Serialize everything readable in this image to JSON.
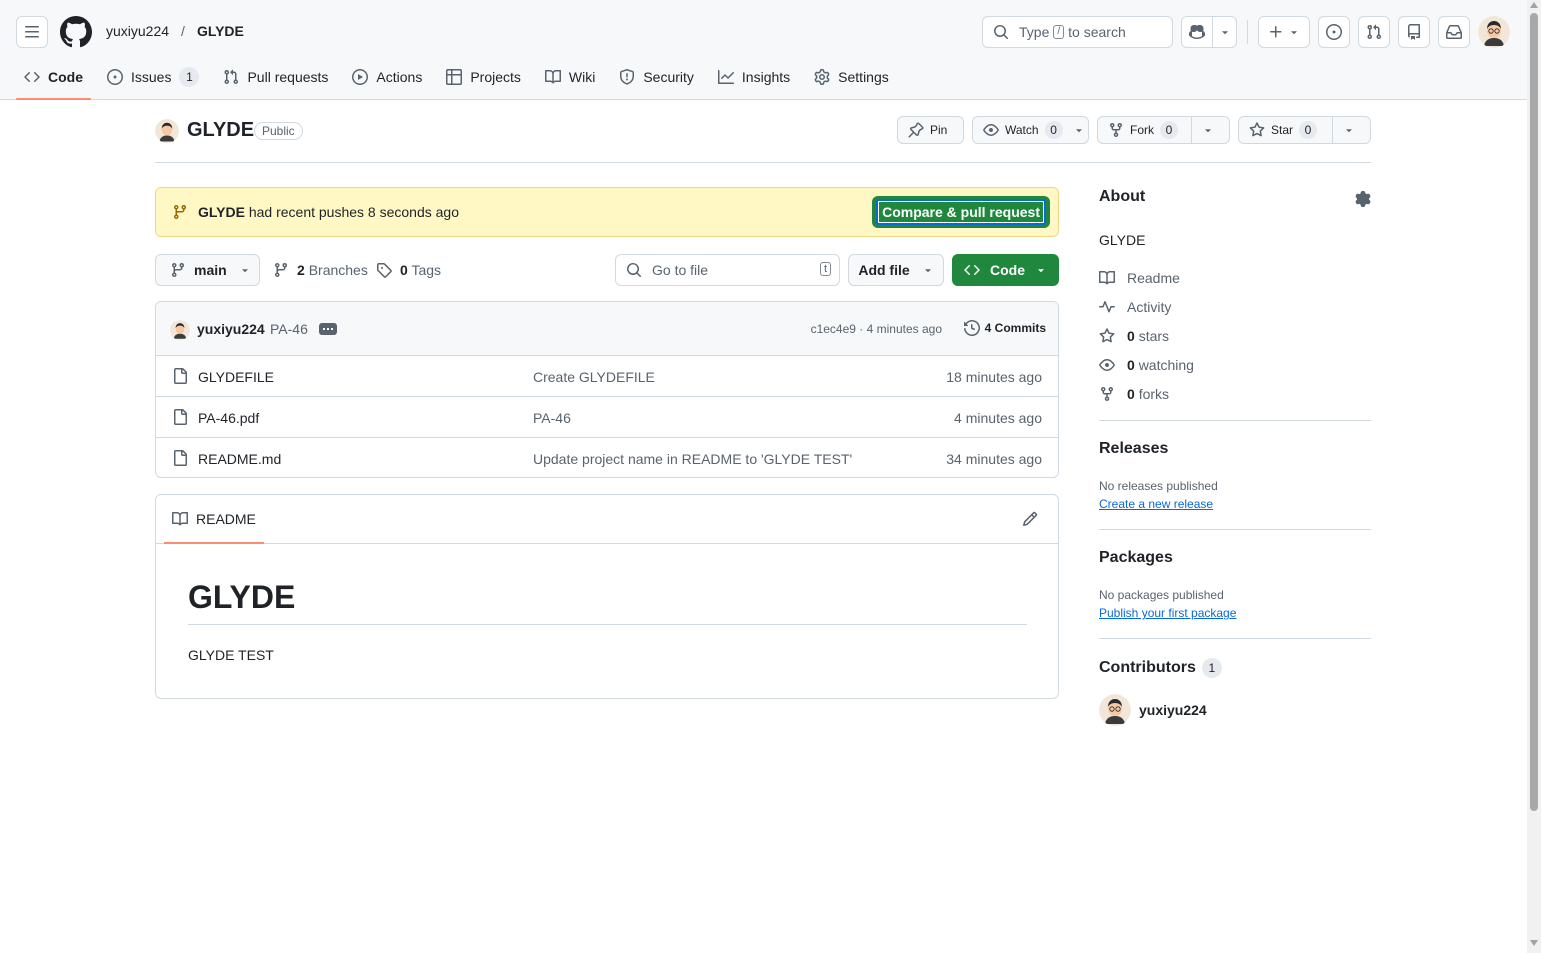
{
  "header": {
    "owner": "yuxiyu224",
    "separator": "/",
    "repo": "GLYDE",
    "search_prefix": "Type",
    "search_key": "/",
    "search_suffix": "to search"
  },
  "nav": [
    {
      "label": "Code",
      "icon": "code-icon",
      "active": true
    },
    {
      "label": "Issues",
      "icon": "issue-icon",
      "count": "1"
    },
    {
      "label": "Pull requests",
      "icon": "pull-request-icon"
    },
    {
      "label": "Actions",
      "icon": "play-icon"
    },
    {
      "label": "Projects",
      "icon": "table-icon"
    },
    {
      "label": "Wiki",
      "icon": "book-icon"
    },
    {
      "label": "Security",
      "icon": "shield-icon"
    },
    {
      "label": "Insights",
      "icon": "graph-icon"
    },
    {
      "label": "Settings",
      "icon": "gear-icon"
    }
  ],
  "repo": {
    "name": "GLYDE",
    "visibility": "Public",
    "pin_label": "Pin",
    "watch_label": "Watch",
    "watch_count": "0",
    "fork_label": "Fork",
    "fork_count": "0",
    "star_label": "Star",
    "star_count": "0"
  },
  "flash": {
    "branch": "GLYDE",
    "text": "had recent pushes 8 seconds ago",
    "button": "Compare & pull request"
  },
  "toolbar": {
    "branch": "main",
    "branches_count": "2",
    "branches_label": "Branches",
    "tags_count": "0",
    "tags_label": "Tags",
    "goto_placeholder": "Go to file",
    "goto_key": "t",
    "add_file": "Add file",
    "code": "Code"
  },
  "commit": {
    "author": "yuxiyu224",
    "message": "PA-46",
    "hash_time": "c1ec4e9 · 4 minutes ago",
    "commits": "4 Commits"
  },
  "files": [
    {
      "name": "GLYDEFILE",
      "message": "Create GLYDEFILE",
      "time": "18 minutes ago"
    },
    {
      "name": "PA-46.pdf",
      "message": "PA-46",
      "time": "4 minutes ago"
    },
    {
      "name": "README.md",
      "message": "Update project name in README to 'GLYDE TEST'",
      "time": "34 minutes ago"
    }
  ],
  "readme": {
    "tab": "README",
    "heading": "GLYDE",
    "body": "GLYDE TEST"
  },
  "about": {
    "title": "About",
    "description": "GLYDE",
    "readme": "Readme",
    "activity": "Activity",
    "stars_count": "0",
    "stars_label": "stars",
    "watching_count": "0",
    "watching_label": "watching",
    "forks_count": "0",
    "forks_label": "forks"
  },
  "releases": {
    "title": "Releases",
    "empty": "No releases published",
    "link": "Create a new release"
  },
  "packages": {
    "title": "Packages",
    "empty": "No packages published",
    "link": "Publish your first package"
  },
  "contributors": {
    "title": "Contributors",
    "count": "1",
    "name": "yuxiyu224"
  },
  "colors": {
    "accent_green": "#1f883d",
    "link_blue": "#0969da",
    "flash_bg": "#fff8c5",
    "tab_underline": "#fd8c73"
  }
}
